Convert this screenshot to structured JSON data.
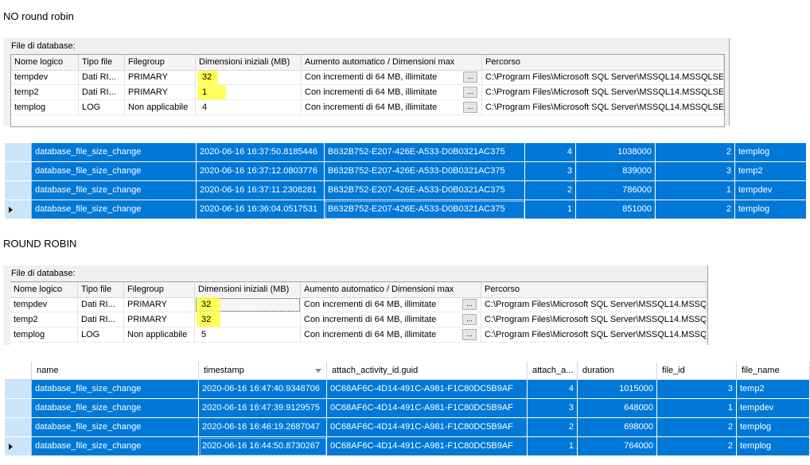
{
  "section1": {
    "heading": "NO round robin"
  },
  "section2": {
    "heading": "ROUND ROBIN"
  },
  "files_panel": {
    "label": "File di database:",
    "columns": [
      "Nome logico",
      "Tipo file",
      "Filegroup",
      "Dimensioni iniziali (MB)",
      "Aumento automatico / Dimensioni max",
      "Percorso"
    ],
    "browse_label": "..."
  },
  "files1": [
    {
      "name": "tempdev",
      "type": "Dati RI...",
      "filegroup": "PRIMARY",
      "size": "32",
      "growth": "Con incrementi di 64 MB, illimitate",
      "path": "C:\\Program Files\\Microsoft SQL Server\\MSSQL14.MSSQLSE"
    },
    {
      "name": "temp2",
      "type": "Dati RI...",
      "filegroup": "PRIMARY",
      "size": "1",
      "growth": "Con incrementi di 64 MB, illimitate",
      "path": "C:\\Program Files\\Microsoft SQL Server\\MSSQL14.MSSQLSE"
    },
    {
      "name": "templog",
      "type": "LOG",
      "filegroup": "Non applicabile",
      "size": "4",
      "growth": "Con incrementi di 64 MB, illimitate",
      "path": "C:\\Program Files\\Microsoft SQL Server\\MSSQL14.MSSQLSE"
    }
  ],
  "files2": [
    {
      "name": "tempdev",
      "type": "Dati RI...",
      "filegroup": "PRIMARY",
      "size": "32",
      "growth": "Con incrementi di 64 MB, illimitate",
      "path": "C:\\Program Files\\Microsoft SQL Server\\MSSQL14.MSSQLS"
    },
    {
      "name": "temp2",
      "type": "Dati RI...",
      "filegroup": "PRIMARY",
      "size": "32",
      "growth": "Con incrementi di 64 MB, illimitate",
      "path": "C:\\Program Files\\Microsoft SQL Server\\MSSQL14.MSSQLS"
    },
    {
      "name": "templog",
      "type": "LOG",
      "filegroup": "Non applicabile",
      "size": "5",
      "growth": "Con incrementi di 64 MB, illimitate",
      "path": "C:\\Program Files\\Microsoft SQL Server\\MSSQL14.MSSQLS"
    }
  ],
  "results_columns": [
    "name",
    "timestamp",
    "attach_activity_id.guid",
    "attach_a...",
    "duration",
    "file_id",
    "file_name"
  ],
  "results1": [
    {
      "name": "database_file_size_change",
      "timestamp": "2020-06-16 16:37:50.8185446",
      "guid": "B632B752-E207-426E-A533-D0B0321AC375",
      "seq": "4",
      "duration": "1038000",
      "file_id": "2",
      "file_name": "templog"
    },
    {
      "name": "database_file_size_change",
      "timestamp": "2020-06-16 16:37:12.0803776",
      "guid": "B632B752-E207-426E-A533-D0B0321AC375",
      "seq": "3",
      "duration": "839000",
      "file_id": "3",
      "file_name": "temp2"
    },
    {
      "name": "database_file_size_change",
      "timestamp": "2020-06-16 16:37:11.2308281",
      "guid": "B632B752-E207-426E-A533-D0B0321AC375",
      "seq": "2",
      "duration": "786000",
      "file_id": "1",
      "file_name": "tempdev"
    },
    {
      "name": "database_file_size_change",
      "timestamp": "2020-06-16 16:36:04.0517531",
      "guid": "B632B752-E207-426E-A533-D0B0321AC375",
      "seq": "1",
      "duration": "851000",
      "file_id": "2",
      "file_name": "templog"
    }
  ],
  "results2": [
    {
      "name": "database_file_size_change",
      "timestamp": "2020-06-16 16:47:40.9348706",
      "guid": "0C68AF6C-4D14-491C-A981-F1C80DC5B9AF",
      "seq": "4",
      "duration": "1015000",
      "file_id": "3",
      "file_name": "temp2"
    },
    {
      "name": "database_file_size_change",
      "timestamp": "2020-06-16 16:47:39.9129575",
      "guid": "0C68AF6C-4D14-491C-A981-F1C80DC5B9AF",
      "seq": "3",
      "duration": "648000",
      "file_id": "1",
      "file_name": "tempdev"
    },
    {
      "name": "database_file_size_change",
      "timestamp": "2020-06-16 16:46:19.2687047",
      "guid": "0C68AF6C-4D14-491C-A981-F1C80DC5B9AF",
      "seq": "2",
      "duration": "698000",
      "file_id": "2",
      "file_name": "templog"
    },
    {
      "name": "database_file_size_change",
      "timestamp": "2020-06-16 16:44:50.8730267",
      "guid": "0C68AF6C-4D14-491C-A981-F1C80DC5B9AF",
      "seq": "1",
      "duration": "764000",
      "file_id": "2",
      "file_name": "templog"
    }
  ],
  "colors": {
    "selection": "#0078d7",
    "highlight": "#ffff3a",
    "panel_bg": "#f0f0f0"
  }
}
